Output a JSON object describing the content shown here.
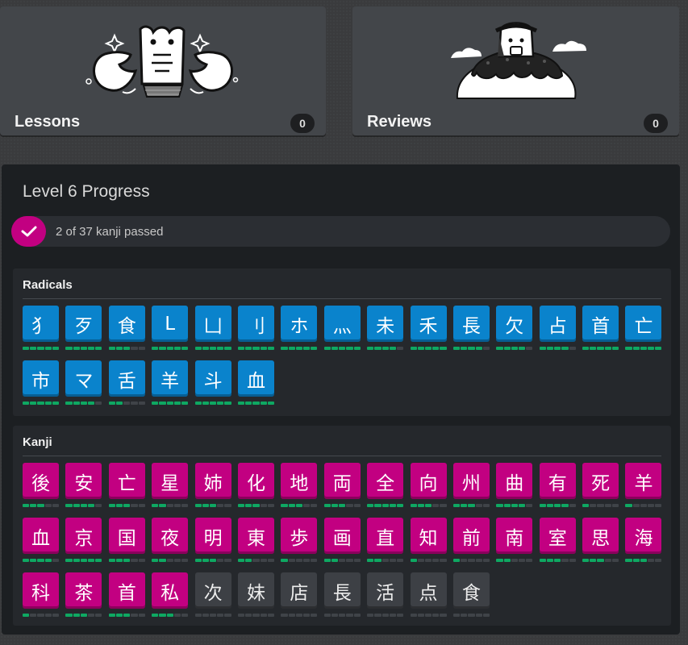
{
  "lessons": {
    "title": "Lessons",
    "count": "0"
  },
  "reviews": {
    "title": "Reviews",
    "count": "0"
  },
  "progress": {
    "title": "Level 6 Progress",
    "passed_text": "2 of 37 kanji passed",
    "colors": {
      "radical": "#0a83cc",
      "kanji": "#c20081",
      "locked": "#3d4045",
      "srs": "#0ea862",
      "passed": "#c20081"
    }
  },
  "radicals": {
    "title": "Radicals",
    "items": [
      {
        "char": "犭",
        "srs": 5,
        "state": "radical"
      },
      {
        "char": "歹",
        "srs": 5,
        "state": "radical"
      },
      {
        "char": "食",
        "srs": 3,
        "state": "radical"
      },
      {
        "char": "L",
        "srs": 5,
        "state": "radical"
      },
      {
        "char": "凵",
        "srs": 5,
        "state": "radical"
      },
      {
        "char": "刂",
        "srs": 5,
        "state": "radical"
      },
      {
        "char": "ホ",
        "srs": 5,
        "state": "radical"
      },
      {
        "char": "灬",
        "srs": 5,
        "state": "radical"
      },
      {
        "char": "未",
        "srs": 4,
        "state": "radical"
      },
      {
        "char": "禾",
        "srs": 5,
        "state": "radical"
      },
      {
        "char": "長",
        "srs": 4,
        "state": "radical"
      },
      {
        "char": "欠",
        "srs": 4,
        "state": "radical"
      },
      {
        "char": "占",
        "srs": 4,
        "state": "radical"
      },
      {
        "char": "首",
        "srs": 5,
        "state": "radical"
      },
      {
        "char": "亡",
        "srs": 5,
        "state": "radical"
      },
      {
        "char": "市",
        "srs": 5,
        "state": "radical"
      },
      {
        "char": "マ",
        "srs": 4,
        "state": "radical"
      },
      {
        "char": "舌",
        "srs": 2,
        "state": "radical"
      },
      {
        "char": "羊",
        "srs": 5,
        "state": "radical"
      },
      {
        "char": "斗",
        "srs": 5,
        "state": "radical"
      },
      {
        "char": "血",
        "srs": 5,
        "state": "radical"
      }
    ]
  },
  "kanji": {
    "title": "Kanji",
    "items": [
      {
        "char": "後",
        "srs": 3,
        "state": "kanji"
      },
      {
        "char": "安",
        "srs": 4,
        "state": "kanji"
      },
      {
        "char": "亡",
        "srs": 3,
        "state": "kanji"
      },
      {
        "char": "星",
        "srs": 2,
        "state": "kanji"
      },
      {
        "char": "姉",
        "srs": 3,
        "state": "kanji"
      },
      {
        "char": "化",
        "srs": 3,
        "state": "kanji"
      },
      {
        "char": "地",
        "srs": 3,
        "state": "kanji"
      },
      {
        "char": "両",
        "srs": 3,
        "state": "kanji"
      },
      {
        "char": "全",
        "srs": 5,
        "state": "kanji"
      },
      {
        "char": "向",
        "srs": 3,
        "state": "kanji"
      },
      {
        "char": "州",
        "srs": 3,
        "state": "kanji"
      },
      {
        "char": "曲",
        "srs": 4,
        "state": "kanji"
      },
      {
        "char": "有",
        "srs": 4,
        "state": "kanji"
      },
      {
        "char": "死",
        "srs": 1,
        "state": "kanji"
      },
      {
        "char": "羊",
        "srs": 1,
        "state": "kanji"
      },
      {
        "char": "血",
        "srs": 4,
        "state": "kanji"
      },
      {
        "char": "京",
        "srs": 5,
        "state": "kanji"
      },
      {
        "char": "国",
        "srs": 3,
        "state": "kanji"
      },
      {
        "char": "夜",
        "srs": 2,
        "state": "kanji"
      },
      {
        "char": "明",
        "srs": 3,
        "state": "kanji"
      },
      {
        "char": "東",
        "srs": 2,
        "state": "kanji"
      },
      {
        "char": "歩",
        "srs": 1,
        "state": "kanji"
      },
      {
        "char": "画",
        "srs": 2,
        "state": "kanji"
      },
      {
        "char": "直",
        "srs": 2,
        "state": "kanji"
      },
      {
        "char": "知",
        "srs": 1,
        "state": "kanji"
      },
      {
        "char": "前",
        "srs": 1,
        "state": "kanji"
      },
      {
        "char": "南",
        "srs": 2,
        "state": "kanji"
      },
      {
        "char": "室",
        "srs": 3,
        "state": "kanji"
      },
      {
        "char": "思",
        "srs": 3,
        "state": "kanji"
      },
      {
        "char": "海",
        "srs": 3,
        "state": "kanji"
      },
      {
        "char": "科",
        "srs": 1,
        "state": "kanji"
      },
      {
        "char": "茶",
        "srs": 3,
        "state": "kanji"
      },
      {
        "char": "首",
        "srs": 3,
        "state": "kanji"
      },
      {
        "char": "私",
        "srs": 3,
        "state": "kanji"
      },
      {
        "char": "次",
        "srs": 0,
        "state": "locked"
      },
      {
        "char": "妹",
        "srs": 0,
        "state": "locked"
      },
      {
        "char": "店",
        "srs": 0,
        "state": "locked"
      },
      {
        "char": "長",
        "srs": 0,
        "state": "locked"
      },
      {
        "char": "活",
        "srs": 0,
        "state": "locked"
      },
      {
        "char": "点",
        "srs": 0,
        "state": "locked"
      },
      {
        "char": "食",
        "srs": 0,
        "state": "locked"
      }
    ]
  }
}
